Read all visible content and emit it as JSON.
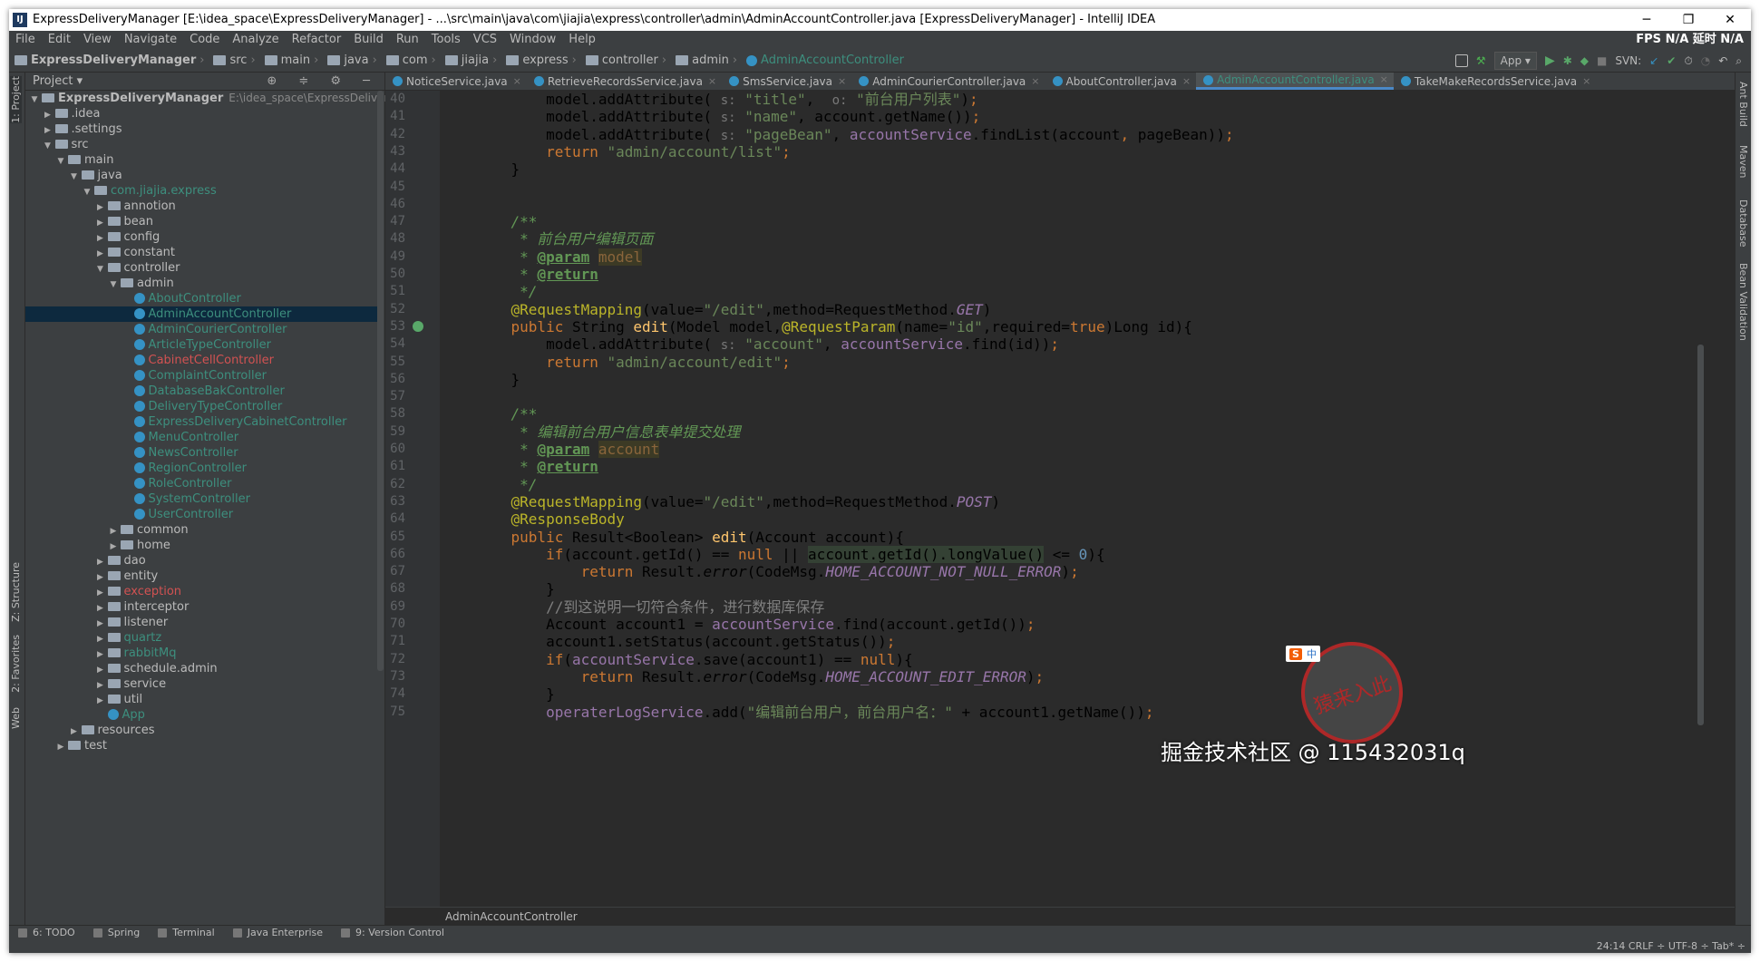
{
  "window": {
    "title": "ExpressDeliveryManager [E:\\idea_space\\ExpressDeliveryManager] - ...\\src\\main\\java\\com\\jiajia\\express\\controller\\admin\\AdminAccountController.java [ExpressDeliveryManager] - IntelliJ IDEA",
    "minimize": "─",
    "maximize": "❐",
    "close": "✕"
  },
  "menu": [
    "File",
    "Edit",
    "View",
    "Navigate",
    "Code",
    "Analyze",
    "Refactor",
    "Build",
    "Run",
    "Tools",
    "VCS",
    "Window",
    "Help"
  ],
  "fps": "FPS  N/A 延时  N/A",
  "navbar": {
    "crumbs": [
      "ExpressDeliveryManager",
      "src",
      "main",
      "java",
      "com",
      "jiajia",
      "express",
      "controller",
      "admin"
    ],
    "current": "AdminAccountController",
    "run_config": "App ▾",
    "svn": "SVN:"
  },
  "sidebar_left": {
    "project": "1: Project",
    "structure": "Z: Structure",
    "favorites": "2: Favorites",
    "web": "Web"
  },
  "project_panel": {
    "header": "Project ▾",
    "header_icons": "⊕ ≑ ⚙ ─",
    "tree": [
      {
        "label": "ExpressDeliveryManager",
        "path": "E:\\idea_space\\ExpressDeliveryManager",
        "arrow": "▼",
        "kind": "folder",
        "bold": true
      },
      {
        "label": ".idea",
        "arrow": "▶",
        "kind": "folder"
      },
      {
        "label": ".settings",
        "arrow": "▶",
        "kind": "folder"
      },
      {
        "label": "src",
        "arrow": "▼",
        "kind": "folder"
      },
      {
        "label": "main",
        "arrow": "▼",
        "kind": "folder"
      },
      {
        "label": "java",
        "arrow": "▼",
        "kind": "folder",
        "color": "#bbb"
      },
      {
        "label": "com.jiajia.express",
        "arrow": "▼",
        "kind": "pkg",
        "color": "#3d8f7e"
      },
      {
        "label": "annotion",
        "arrow": "▶",
        "kind": "pkg"
      },
      {
        "label": "bean",
        "arrow": "▶",
        "kind": "pkg"
      },
      {
        "label": "config",
        "arrow": "▶",
        "kind": "pkg"
      },
      {
        "label": "constant",
        "arrow": "▶",
        "kind": "pkg"
      },
      {
        "label": "controller",
        "arrow": "▼",
        "kind": "pkg"
      },
      {
        "label": "admin",
        "arrow": "▼",
        "kind": "pkg"
      },
      {
        "label": "AboutController",
        "kind": "class",
        "color": "#3d8f7e"
      },
      {
        "label": "AdminAccountController",
        "kind": "class",
        "color": "#3d8f7e",
        "selected": true
      },
      {
        "label": "AdminCourierController",
        "kind": "class",
        "color": "#3d8f7e"
      },
      {
        "label": "ArticleTypeController",
        "kind": "class",
        "color": "#3d8f7e"
      },
      {
        "label": "CabinetCellController",
        "kind": "class",
        "color": "#d25252"
      },
      {
        "label": "ComplaintController",
        "kind": "class",
        "color": "#3d8f7e"
      },
      {
        "label": "DatabaseBakController",
        "kind": "class",
        "color": "#3d8f7e"
      },
      {
        "label": "DeliveryTypeController",
        "kind": "class",
        "color": "#3d8f7e"
      },
      {
        "label": "ExpressDeliveryCabinetController",
        "kind": "class",
        "color": "#3d8f7e"
      },
      {
        "label": "MenuController",
        "kind": "class",
        "color": "#3d8f7e"
      },
      {
        "label": "NewsController",
        "kind": "class",
        "color": "#3d8f7e"
      },
      {
        "label": "RegionController",
        "kind": "class",
        "color": "#3d8f7e"
      },
      {
        "label": "RoleController",
        "kind": "class",
        "color": "#3d8f7e"
      },
      {
        "label": "SystemController",
        "kind": "class",
        "color": "#3d8f7e"
      },
      {
        "label": "UserController",
        "kind": "class",
        "color": "#3d8f7e"
      },
      {
        "label": "common",
        "arrow": "▶",
        "kind": "pkg"
      },
      {
        "label": "home",
        "arrow": "▶",
        "kind": "pkg"
      },
      {
        "label": "dao",
        "arrow": "▶",
        "kind": "pkg"
      },
      {
        "label": "entity",
        "arrow": "▶",
        "kind": "pkg"
      },
      {
        "label": "exception",
        "arrow": "▶",
        "kind": "pkg",
        "color": "#d25252"
      },
      {
        "label": "interceptor",
        "arrow": "▶",
        "kind": "pkg"
      },
      {
        "label": "listener",
        "arrow": "▶",
        "kind": "pkg"
      },
      {
        "label": "quartz",
        "arrow": "▶",
        "kind": "pkg",
        "color": "#3d8f7e"
      },
      {
        "label": "rabbitMq",
        "arrow": "▶",
        "kind": "pkg",
        "color": "#3d8f7e"
      },
      {
        "label": "schedule.admin",
        "arrow": "▶",
        "kind": "pkg"
      },
      {
        "label": "service",
        "arrow": "▶",
        "kind": "pkg"
      },
      {
        "label": "util",
        "arrow": "▶",
        "kind": "pkg"
      },
      {
        "label": "App",
        "kind": "class",
        "color": "#3d8f7e"
      },
      {
        "label": "resources",
        "arrow": "▶",
        "kind": "folder"
      },
      {
        "label": "test",
        "arrow": "▶",
        "kind": "folder"
      }
    ]
  },
  "editor": {
    "tabs": [
      {
        "label": "NoticeService.java",
        "color": "#bbb"
      },
      {
        "label": "RetrieveRecordsService.java",
        "color": "#bbb"
      },
      {
        "label": "SmsService.java",
        "color": "#bbb"
      },
      {
        "label": "AdminCourierController.java",
        "color": "#bbb"
      },
      {
        "label": "AboutController.java",
        "color": "#bbb"
      },
      {
        "label": "AdminAccountController.java",
        "color": "#3d8f7e",
        "active": true
      },
      {
        "label": "TakeMakeRecordsService.java",
        "color": "#bbb"
      }
    ],
    "bottom_breadcrumb": "AdminAccountController",
    "lines": [
      {
        "n": "40",
        "html": "        model.addAttribute( <span class='hint'>s:</span> <span class='str'>\"title\"</span>,  <span class='hint'>o:</span> <span class='str'>\"前台用户列表\"</span>)<span class='kw'>;</span>"
      },
      {
        "n": "41",
        "html": "        model.addAttribute( <span class='hint'>s:</span> <span class='str'>\"name\"</span>, account.getName())<span class='kw'>;</span>"
      },
      {
        "n": "42",
        "html": "        model.addAttribute( <span class='hint'>s:</span> <span class='str'>\"pageBean\"</span>, <span class='mem'>accountService</span>.findList(account<span class='kw'>,</span> pageBean))<span class='kw'>;</span>"
      },
      {
        "n": "43",
        "html": "        <span class='kw'>return</span> <span class='str'>\"admin/account/list\"</span><span class='kw'>;</span>"
      },
      {
        "n": "44",
        "html": "    }"
      },
      {
        "n": "45",
        "html": ""
      },
      {
        "n": "46",
        "html": ""
      },
      {
        "n": "47",
        "html": "    <span class='cm'>/**</span>"
      },
      {
        "n": "48",
        "html": "<span class='cm'>     * 前台用户编辑页面</span>"
      },
      {
        "n": "49",
        "html": "<span class='cm'>     * </span><span class='tg'>@param</span> <span class='pm'>model</span>"
      },
      {
        "n": "50",
        "html": "<span class='cm'>     * </span><span class='tg'>@return</span>"
      },
      {
        "n": "51",
        "html": "<span class='cm'>     */</span>"
      },
      {
        "n": "52",
        "html": "    <span class='an'>@RequestMapping</span>(value=<span class='str'>\"/edit\"</span>,method=RequestMethod.<span class='fld'>GET</span>)"
      },
      {
        "n": "53",
        "html": "    <span class='kw'>public</span> String <span class='fn'>edit</span>(Model model,<span class='an'>@RequestParam</span>(name=<span class='str'>\"id\"</span>,required=<span class='kw'>true</span>)Long id){"
      },
      {
        "n": "54",
        "html": "        model.addAttribute( <span class='hint'>s:</span> <span class='str'>\"account\"</span>, <span class='mem'>accountService</span>.find(id))<span class='kw'>;</span>"
      },
      {
        "n": "55",
        "html": "        <span class='kw'>return</span> <span class='str'>\"admin/account/edit\"</span><span class='kw'>;</span>"
      },
      {
        "n": "56",
        "html": "    }"
      },
      {
        "n": "57",
        "html": ""
      },
      {
        "n": "58",
        "html": "    <span class='cm'>/**</span>"
      },
      {
        "n": "59",
        "html": "<span class='cm'>     * 编辑前台用户信息表单提交处理</span>"
      },
      {
        "n": "60",
        "html": "<span class='cm'>     * </span><span class='tg'>@param</span> <span class='pm'>account</span>"
      },
      {
        "n": "61",
        "html": "<span class='cm'>     * </span><span class='tg'>@return</span>"
      },
      {
        "n": "62",
        "html": "<span class='cm'>     */</span>"
      },
      {
        "n": "63",
        "html": "    <span class='an'>@RequestMapping</span>(value=<span class='str'>\"/edit\"</span>,method=RequestMethod.<span class='fld'>POST</span>)"
      },
      {
        "n": "64",
        "html": "    <span class='an'>@ResponseBody</span>"
      },
      {
        "n": "65",
        "html": "    <span class='kw'>public</span> Result&lt;Boolean&gt; <span class='fn'>edit</span>(Account account){"
      },
      {
        "n": "66",
        "html": "        <span class='kw'>if</span>(account.getId() == <span class='kw'>null</span> || <span class='hl'>account.getId().longValue()</span> &lt;= <span class='num'>0</span>){"
      },
      {
        "n": "67",
        "html": "            <span class='kw'>return</span> Result.<span class='it'>error</span>(CodeMsg.<span class='fld'>HOME_ACCOUNT_NOT_NULL_ERROR</span>)<span class='kw'>;</span>"
      },
      {
        "n": "68",
        "html": "        }"
      },
      {
        "n": "69",
        "html": "        <span class='cmg'>//到这说明一切符合条件，进行数据库保存</span>"
      },
      {
        "n": "70",
        "html": "        Account account1 = <span class='mem'>accountService</span>.find(account.getId())<span class='kw'>;</span>"
      },
      {
        "n": "71",
        "html": "        account1.setStatus(account.getStatus())<span class='kw'>;</span>"
      },
      {
        "n": "72",
        "html": "        <span class='kw'>if</span>(<span class='mem'>accountService</span>.save(account1) == <span class='kw'>null</span>){"
      },
      {
        "n": "73",
        "html": "            <span class='kw'>return</span> Result.<span class='it'>error</span>(CodeMsg.<span class='fld'>HOME_ACCOUNT_EDIT_ERROR</span>)<span class='kw'>;</span>"
      },
      {
        "n": "74",
        "html": "        }"
      },
      {
        "n": "75",
        "html": "        <span class='mem'>operaterLogService</span>.add(<span class='str'>\"编辑前台用户，前台用户名：\"</span> + account1.getName())<span class='kw'>;</span>"
      }
    ]
  },
  "sidebar_right": {
    "ant": "Ant Build",
    "maven": "Maven",
    "database": "Database",
    "bean": "Bean Validation"
  },
  "bottom_tools": [
    "6: TODO",
    "Spring",
    "Terminal",
    "Java Enterprise",
    "9: Version Control"
  ],
  "status": "24:14   CRLF ÷   UTF-8 ÷   Tab* ÷",
  "overlay": {
    "watermark": "掘金技术社区 @ 115432031q",
    "stamp": "猿来入此",
    "ime": "中"
  },
  "colors": {
    "accent": "#4a88c7",
    "keyword": "#cc7832",
    "string": "#6a8759",
    "annotation": "#bbb529",
    "selected_row": "#0d293e"
  }
}
